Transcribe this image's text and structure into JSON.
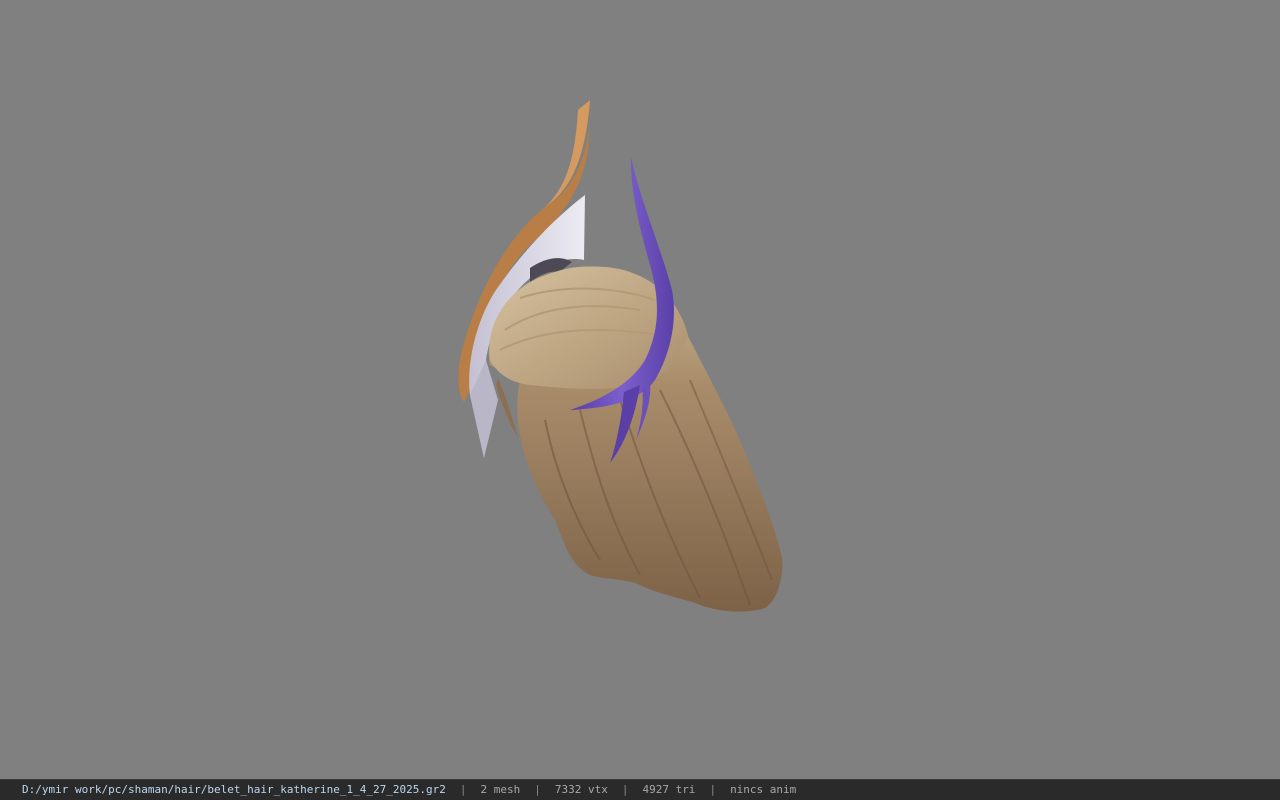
{
  "viewport": {
    "background_color": "#808080",
    "model_name": "belet_hair_katherine"
  },
  "status_bar": {
    "file_path": "D:/ymir work/pc/shaman/hair/belet_hair_katherine_1_4_27_2025.gr2",
    "separator": "|",
    "mesh_count": "2 mesh",
    "vertex_count": "7332 vtx",
    "triangle_count": "4927 tri",
    "anim_status": "nincs anim"
  },
  "colors": {
    "hair_base": "#a08566",
    "hair_highlight": "#c9b291",
    "horn_purple": "#6a4fb8",
    "crest_silver": "#d8d4e4",
    "crest_gold": "#c08850"
  }
}
